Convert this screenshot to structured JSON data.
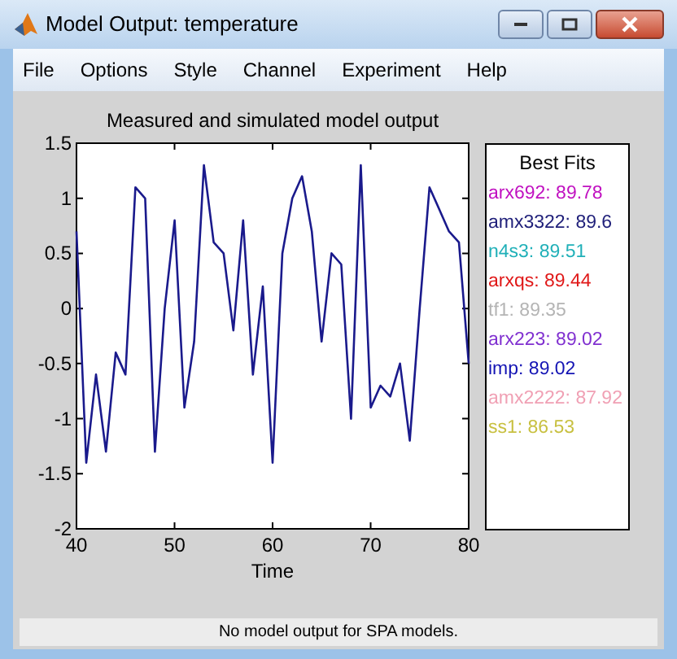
{
  "window": {
    "title": "Model Output: temperature"
  },
  "menu": [
    "File",
    "Options",
    "Style",
    "Channel",
    "Experiment",
    "Help"
  ],
  "plot": {
    "chart_data": {
      "type": "line",
      "title": "Measured and simulated model output",
      "xlabel": "Time",
      "xlim": [
        40,
        80
      ],
      "ylim": [
        -2,
        1.5
      ],
      "xticks": [
        40,
        50,
        60,
        70,
        80
      ],
      "yticks": [
        {
          "value": -2,
          "label": "-2"
        },
        {
          "value": -1.5,
          "label": "-1.5"
        },
        {
          "value": -1,
          "label": "-1"
        },
        {
          "value": -0.5,
          "label": "-0.5"
        },
        {
          "value": 0,
          "label": "0"
        },
        {
          "value": 0.5,
          "label": "0.5"
        },
        {
          "value": 1,
          "label": "1"
        },
        {
          "value": 1.5,
          "label": "1.5"
        }
      ],
      "x": [
        40,
        41,
        42,
        43,
        44,
        45,
        46,
        47,
        48,
        49,
        50,
        51,
        52,
        53,
        54,
        55,
        56,
        57,
        58,
        59,
        60,
        61,
        62,
        63,
        64,
        65,
        66,
        67,
        68,
        69,
        70,
        71,
        72,
        73,
        74,
        75,
        76,
        77,
        78,
        79,
        80
      ],
      "series": [
        {
          "color": "#1a1a8c",
          "values": [
            0.7,
            -1.4,
            -0.6,
            -1.3,
            -0.4,
            -0.6,
            1.1,
            1.0,
            -1.3,
            0.0,
            0.8,
            -0.9,
            -0.3,
            1.3,
            0.6,
            0.5,
            -0.2,
            0.8,
            -0.6,
            0.2,
            -1.4,
            0.5,
            1.0,
            1.2,
            0.7,
            -0.3,
            0.5,
            0.4,
            -1.0,
            1.3,
            -0.9,
            -0.7,
            -0.8,
            -0.5,
            -1.2,
            0.0,
            1.1,
            0.9,
            0.7,
            0.6,
            -0.5
          ]
        }
      ]
    }
  },
  "best_fits": {
    "title": "Best Fits",
    "items": [
      {
        "label": "arx692: 89.78",
        "color": "#c010c0"
      },
      {
        "label": "amx3322: 89.6",
        "color": "#20207a"
      },
      {
        "label": "n4s3: 89.51",
        "color": "#20b0b8"
      },
      {
        "label": "arxqs: 89.44",
        "color": "#e01818"
      },
      {
        "label": "tf1: 89.35",
        "color": "#b4b4b4"
      },
      {
        "label": "arx223: 89.02",
        "color": "#8030d0"
      },
      {
        "label": "imp: 89.02",
        "color": "#1414b4"
      },
      {
        "label": "amx2222: 87.92",
        "color": "#f0a0b4"
      },
      {
        "label": "ss1: 86.53",
        "color": "#c8c040"
      }
    ]
  },
  "status_bar": "No model output for SPA models."
}
